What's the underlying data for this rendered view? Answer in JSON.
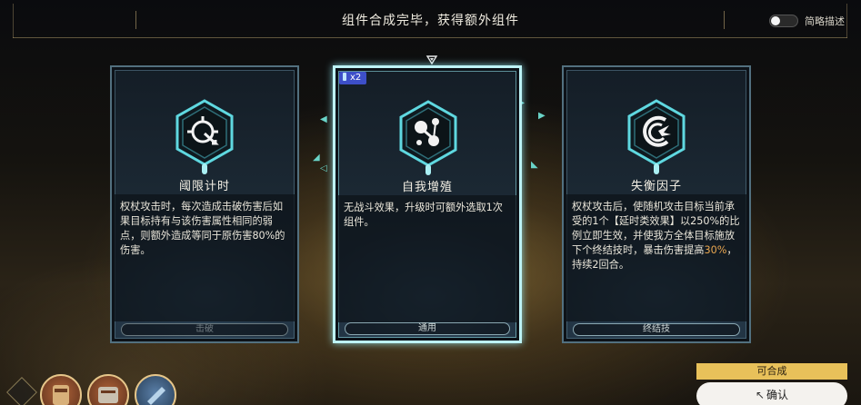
{
  "header": {
    "title": "组件合成完毕，获得额外组件",
    "toggle_label": "简略描述",
    "toggle_on": false
  },
  "cards": [
    {
      "name": "阈限计时",
      "icon": "crosshair-arrow-icon",
      "description": "权杖攻击时，每次造成击破伤害后如果目标持有与该伤害属性相同的弱点，则额外造成等同于原伤害80%的伤害。",
      "tag": "击破",
      "selected": false
    },
    {
      "name": "自我增殖",
      "icon": "molecule-icon",
      "description": "无战斗效果，升级时可额外选取1次组件。",
      "tag": "通用",
      "badge": "x2",
      "selected": true
    },
    {
      "name": "失衡因子",
      "icon": "claw-swirl-icon",
      "description_before": "权杖攻击后，使随机攻击目标当前承受的1个【延时类效果】以250%的比例立即生效，并使我方全体目标施放下个终结技时，暴击伤害提高",
      "description_highlight": "30%",
      "description_after": "，持续2回合。",
      "tag": "终结技",
      "selected": false
    }
  ],
  "footer": {
    "craftable_label": "可合成",
    "confirm_label": "确认"
  },
  "colors": {
    "selected_border": "#bdf3f6",
    "highlight": "#e9a650",
    "craftable_bg": "#e8c15a",
    "badge_bg": "#3d4fc8"
  }
}
